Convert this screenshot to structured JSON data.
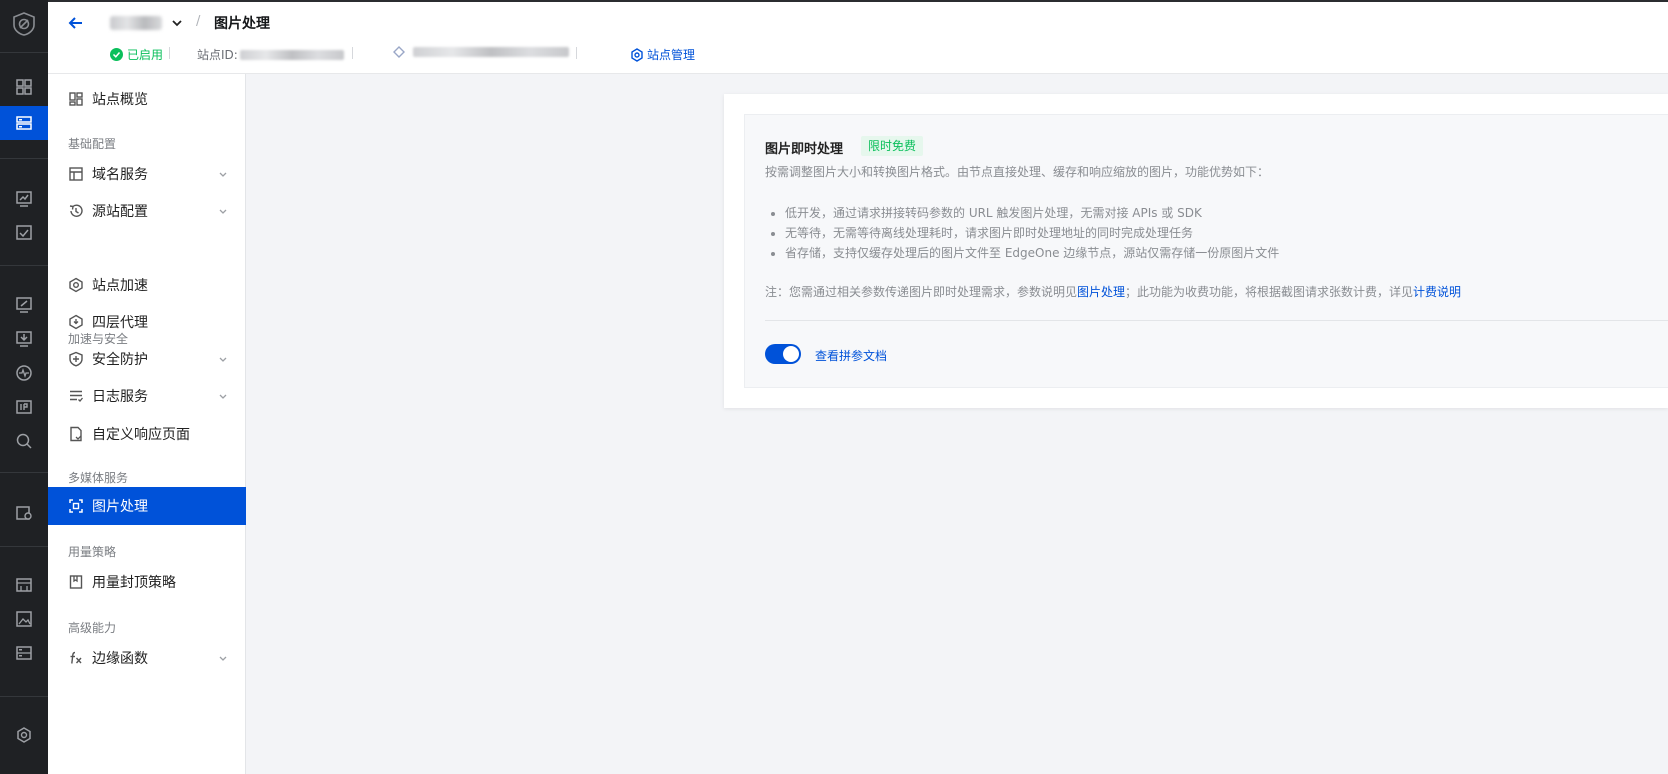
{
  "header": {
    "page_title": "图片处理",
    "breadcrumb_sep": "/",
    "status": "已启用",
    "site_id_label": "站点ID:",
    "manage_label": "站点管理"
  },
  "sidebar": {
    "overview": "站点概览",
    "groups": [
      "基础配置",
      "加速与安全",
      "多媒体服务",
      "用量策略",
      "高级能力"
    ],
    "items": [
      {
        "label": "域名服务"
      },
      {
        "label": "源站配置"
      },
      {
        "label": "站点加速"
      },
      {
        "label": "四层代理"
      },
      {
        "label": "安全防护"
      },
      {
        "label": "日志服务"
      },
      {
        "label": "自定义响应页面"
      },
      {
        "label": "图片处理"
      },
      {
        "label": "用量封顶策略"
      },
      {
        "label": "边缘函数"
      }
    ]
  },
  "card": {
    "title": "图片即时处理",
    "tag": "限时免费",
    "desc": "按需调整图片大小和转换图片格式。由节点直接处理、缓存和响应缩放的图片，功能优势如下：",
    "bullets": [
      "低开发，通过请求拼接转码参数的 URL 触发图片处理，无需对接 APIs 或 SDK",
      "无等待，无需等待离线处理耗时，请求图片即时处理地址的同时完成处理任务",
      "省存储，支持仅缓存处理后的图片文件至 EdgeOne 边缘节点，源站仅需存储一份原图片文件"
    ],
    "note_prefix": "注：您需通过相关参数传递图片即时处理需求，参数说明见",
    "note_link1": "图片处理",
    "note_middle": "；此功能为收费功能，将根据截图请求张数计费，详见",
    "note_link2": "计费说明",
    "toggle_label": "查看拼参文档",
    "toggle_on": true
  },
  "colors": {
    "brand": "#0052d9",
    "success": "#0abf5b",
    "rail": "#1f2124"
  }
}
